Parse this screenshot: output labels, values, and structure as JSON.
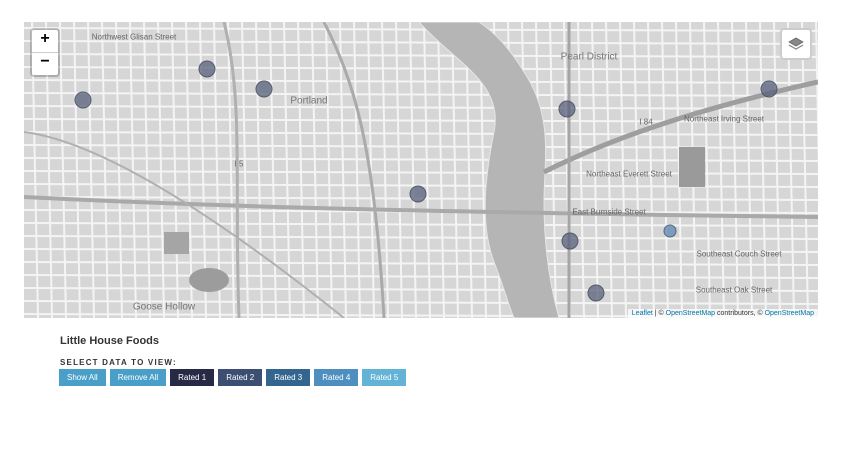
{
  "map": {
    "zoom_in": "+",
    "zoom_out": "−",
    "layers_icon": "layers-icon",
    "attribution": {
      "leaflet": "Leaflet",
      "sep1": " | © ",
      "osm1": "OpenStreetMap",
      "sep2": " contributors, © ",
      "osm2": "OpenStreetMap"
    },
    "labels": {
      "downtown": "Portland",
      "pearl": "Pearl District",
      "burnside": "East Burnside Street",
      "irving": "Northeast Irving Street",
      "everett": "Northeast Everett Street",
      "glisan": "Northwest Glisan Street",
      "couch": "Southeast Couch Street",
      "oak": "Southeast Oak Street",
      "hollow": "Goose Hollow",
      "i5": "I 84",
      "i84": "I 5"
    }
  },
  "page": {
    "title": "Little House Foods",
    "select_label": "SELECT DATA TO VIEW:"
  },
  "buttons": [
    {
      "label": "Show All",
      "color": "#4a9fc9"
    },
    {
      "label": "Remove All",
      "color": "#4a9fc9"
    },
    {
      "label": "Rated 1",
      "color": "#262a45"
    },
    {
      "label": "Rated 2",
      "color": "#3c4f72"
    },
    {
      "label": "Rated 3",
      "color": "#34658f"
    },
    {
      "label": "Rated 4",
      "color": "#4f8fbf"
    },
    {
      "label": "Rated 5",
      "color": "#62b3d6"
    }
  ],
  "colors": {
    "marker": "#58607a",
    "map_bg": "#d9d9d9"
  }
}
